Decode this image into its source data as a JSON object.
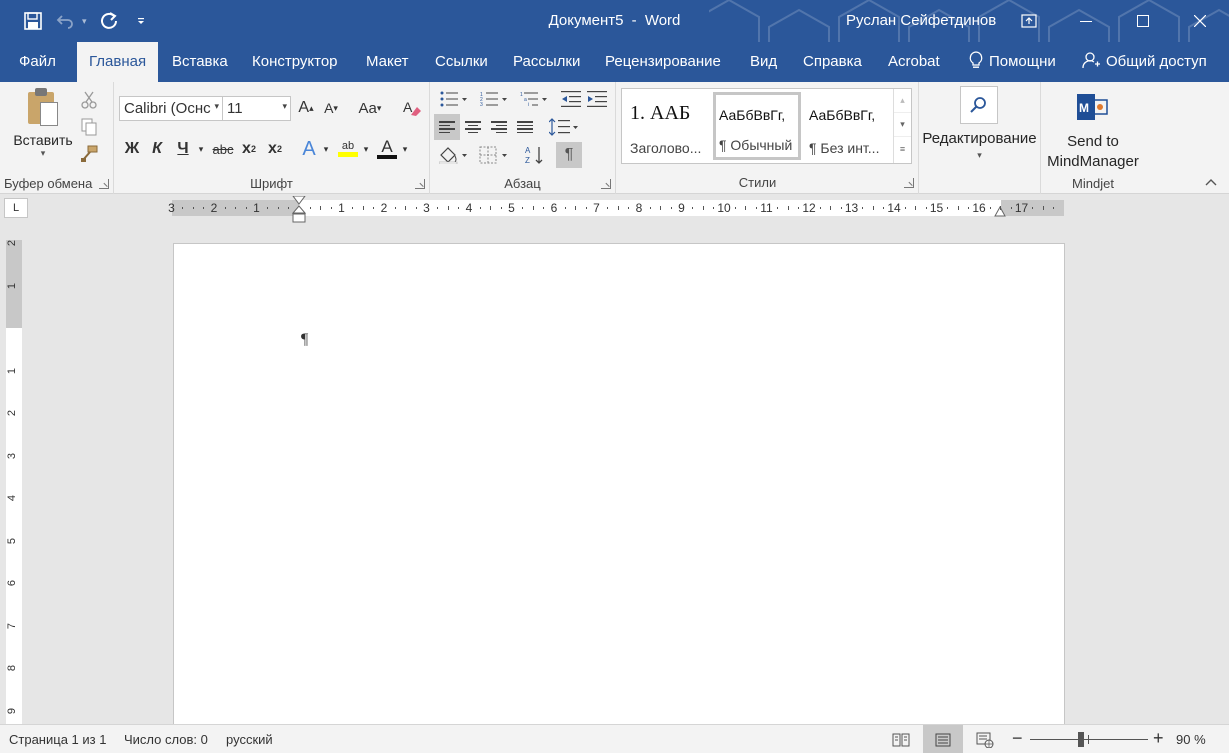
{
  "titlebar": {
    "doc_name": "Документ5",
    "separator": "-",
    "app_name": "Word",
    "user": "Руслан Сейфетдинов"
  },
  "tabs": [
    {
      "label": "Файл"
    },
    {
      "label": "Главная"
    },
    {
      "label": "Вставка"
    },
    {
      "label": "Конструктор"
    },
    {
      "label": "Макет"
    },
    {
      "label": "Ссылки"
    },
    {
      "label": "Рассылки"
    },
    {
      "label": "Рецензирование"
    },
    {
      "label": "Вид"
    },
    {
      "label": "Справка"
    },
    {
      "label": "Acrobat"
    },
    {
      "label": "Помощни"
    },
    {
      "label": "Общий доступ"
    }
  ],
  "ribbon": {
    "clipboard": {
      "paste_label": "Вставить",
      "group_label": "Буфер обмена"
    },
    "font": {
      "font_name": "Calibri (Оснс",
      "font_size": "11",
      "grow": "A",
      "shrink": "A",
      "case": "Aa",
      "bold": "Ж",
      "italic": "К",
      "underline": "Ч",
      "strike": "abc",
      "subscript": "x",
      "subscript_mark": "2",
      "superscript": "x",
      "superscript_mark": "2",
      "effects": "A",
      "highlight": "ab",
      "color_letter": "A",
      "group_label": "Шрифт"
    },
    "paragraph": {
      "group_label": "Абзац",
      "pilcrow": "¶"
    },
    "styles": {
      "items": [
        {
          "sample": "1.  ААБ",
          "name": "Заголово..."
        },
        {
          "sample": "АаБбВвГг,",
          "name": "¶ Обычный"
        },
        {
          "sample": "АаБбВвГг,",
          "name": "¶ Без инт..."
        }
      ],
      "group_label": "Стили"
    },
    "editing": {
      "label": "Редактирование"
    },
    "mindjet": {
      "line1": "Send to",
      "line2": "MindManager",
      "group_label": "Mindjet"
    }
  },
  "ruler": {
    "tab_selector": "L",
    "h_numbers": [
      "3",
      "2",
      "1",
      "1",
      "2",
      "3",
      "4",
      "5",
      "6",
      "7",
      "8",
      "9",
      "10",
      "11",
      "12",
      "13",
      "14",
      "15",
      "16",
      "17"
    ],
    "v_numbers": [
      "2",
      "1",
      "1",
      "2",
      "3",
      "4",
      "5",
      "6",
      "7",
      "8",
      "9"
    ]
  },
  "document": {
    "pilcrow": "¶"
  },
  "statusbar": {
    "page": "Страница 1 из 1",
    "words": "Число слов: 0",
    "language": "русский",
    "zoom_minus": "−",
    "zoom_plus": "+",
    "zoom": "90 %"
  },
  "colors": {
    "brand": "#2b579a",
    "ribbon_bg": "#f3f3f3",
    "highlight_yellow": "#ffff00",
    "font_color_red": "#ff0000"
  }
}
